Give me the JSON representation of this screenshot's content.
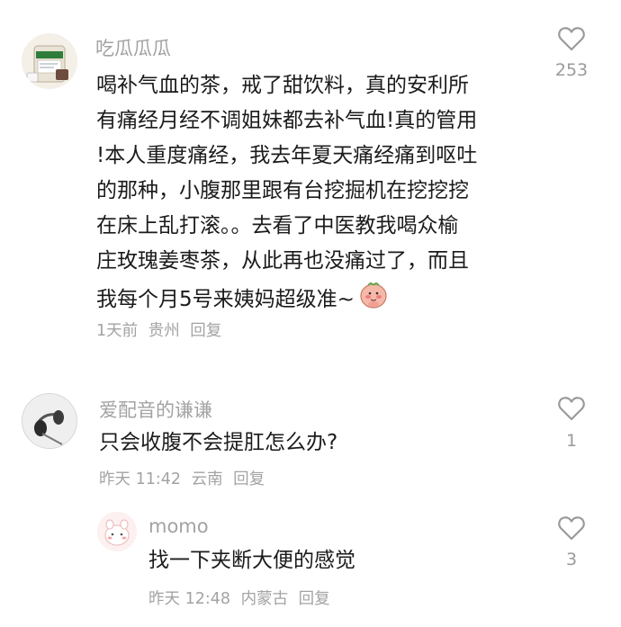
{
  "comments": [
    {
      "username": "吃瓜瓜瓜",
      "text_lines": [
        "喝补气血的茶，戒了甜饮料，真的安利所",
        "有痛经月经不调姐妹都去补气血!真的管用",
        "!本人重度痛经，我去年夏天痛经痛到呕吐",
        "的那种，小腹那里跟有台挖掘机在挖挖挖",
        "在床上乱打滚。。去看了中医教我喝众榆",
        "庄玫瑰姜枣茶，从此再也没痛过了，而且",
        "我每个月5号来姨妈超级准~"
      ],
      "time": "1天前",
      "location": "贵州",
      "reply_label": "回复",
      "likes": "253",
      "emoji": "shy-face-emoji"
    },
    {
      "username": "爱配音的谦谦",
      "text": "只会收腹不会提肛怎么办?",
      "time": "昨天 11:42",
      "location": "云南",
      "reply_label": "回复",
      "likes": "1"
    },
    {
      "username": "momo",
      "text": "找一下夹断大便的感觉",
      "time": "昨天 12:48",
      "location": "内蒙古",
      "reply_label": "回复",
      "likes": "3"
    }
  ],
  "colors": {
    "text": "#1b1b1b",
    "muted": "#a3a3a3",
    "background": "#ffffff"
  }
}
